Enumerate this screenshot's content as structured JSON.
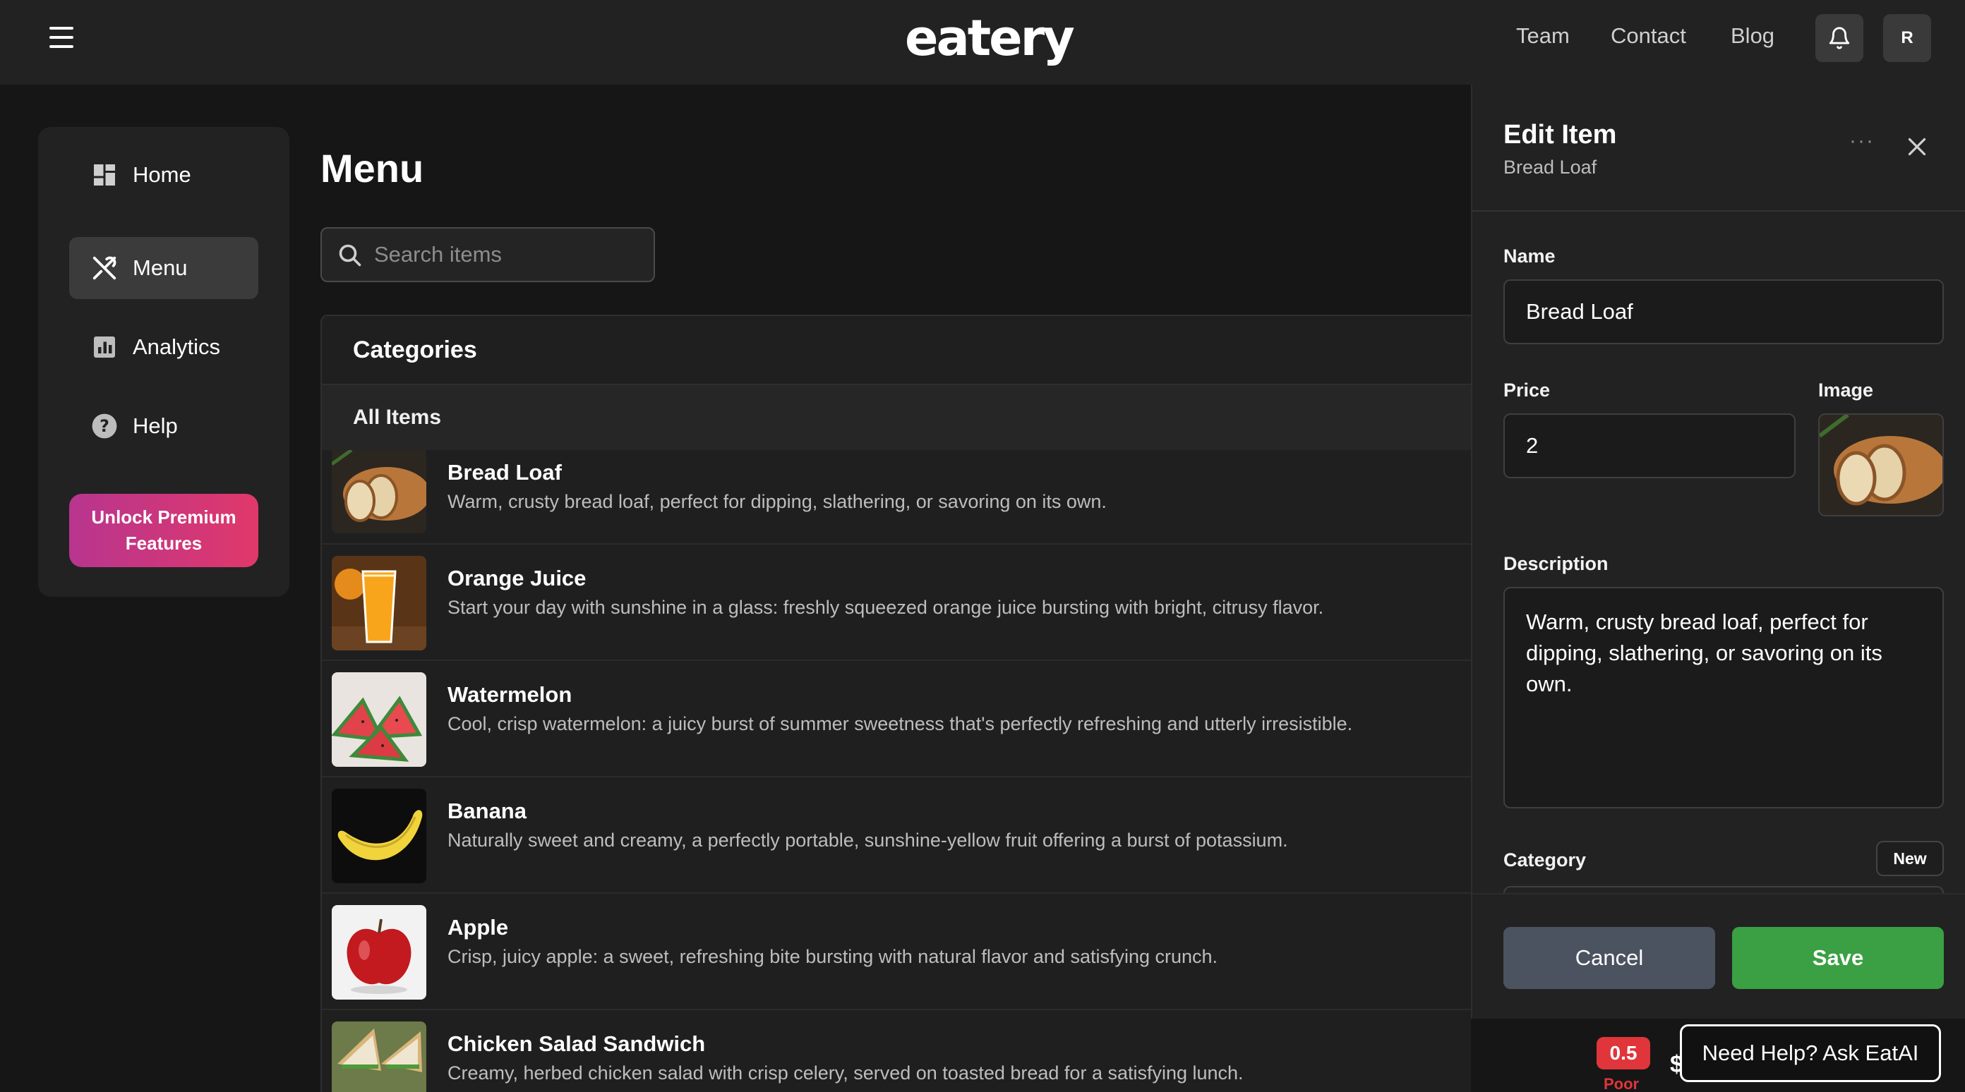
{
  "header": {
    "logo_text": "eatery",
    "nav": [
      "Team",
      "Contact",
      "Blog"
    ],
    "avatar_initial": "R"
  },
  "sidebar": {
    "items": [
      {
        "label": "Home",
        "icon": "dashboard-icon"
      },
      {
        "label": "Menu",
        "icon": "utensils-icon",
        "active": true
      },
      {
        "label": "Analytics",
        "icon": "bar-chart-icon"
      },
      {
        "label": "Help",
        "icon": "question-circle-icon"
      }
    ],
    "premium_line1": "Unlock Premium",
    "premium_line2": "Features"
  },
  "main": {
    "title": "Menu",
    "search_placeholder": "Search items",
    "categories_title": "Categories",
    "all_items_label": "All Items",
    "items": [
      {
        "name": "Bread Loaf",
        "description": "Warm, crusty bread loaf, perfect for dipping, slathering, or savoring on its own."
      },
      {
        "name": "Orange Juice",
        "description": "Start your day with sunshine in a glass: freshly squeezed orange juice bursting with bright, citrusy flavor."
      },
      {
        "name": "Watermelon",
        "description": "Cool, crisp watermelon: a juicy burst of summer sweetness that's perfectly refreshing and utterly irresistible."
      },
      {
        "name": "Banana",
        "description": "Naturally sweet and creamy, a perfectly portable, sunshine-yellow fruit offering a burst of potassium."
      },
      {
        "name": "Apple",
        "description": "Crisp, juicy apple: a sweet, refreshing bite bursting with natural flavor and satisfying crunch."
      },
      {
        "name": "Chicken Salad Sandwich",
        "description": "Creamy, herbed chicken salad with crisp celery, served on toasted bread for a satisfying lunch."
      }
    ]
  },
  "drawer": {
    "title": "Edit Item",
    "subtitle": "Bread Loaf",
    "more_label": "···",
    "name_label": "Name",
    "name_value": "Bread Loaf",
    "price_label": "Price",
    "price_value": "2",
    "image_label": "Image",
    "description_label": "Description",
    "description_value": "Warm, crusty bread loaf, perfect for dipping, slathering, or savoring on its own.",
    "category_label": "Category",
    "new_label": "New",
    "cancel_label": "Cancel",
    "save_label": "Save"
  },
  "footer": {
    "score_value": "0.5",
    "score_label": "Poor",
    "dollar_glyph": "$",
    "help_label": "Need Help? Ask EatAI"
  },
  "colors": {
    "accent_green": "#3aa043",
    "cancel_gray": "#4b5361",
    "score_red": "#e0353a",
    "premium_gradient_start": "#b8358f",
    "premium_gradient_end": "#e0386a"
  }
}
